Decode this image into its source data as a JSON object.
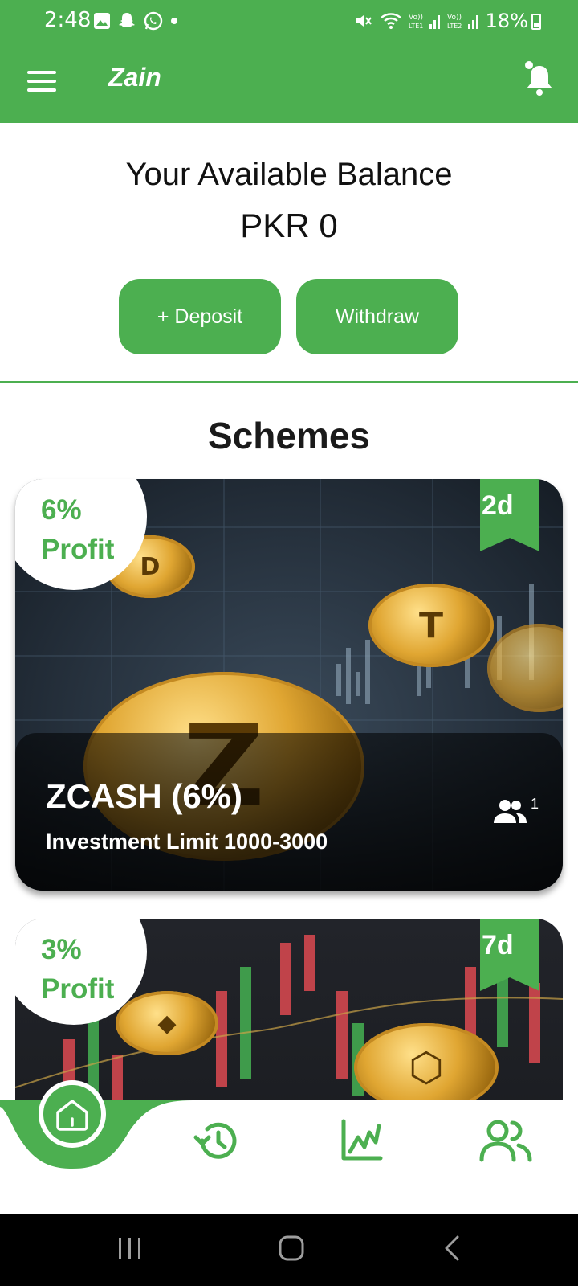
{
  "status_bar": {
    "time": "2:48",
    "battery": "18%",
    "network_labels": [
      "Vo)) LTE1",
      "Vo)) LTE2"
    ]
  },
  "app_bar": {
    "title": "Zain",
    "menu_icon": "hamburger-menu-icon",
    "notification_icon": "bell-icon"
  },
  "balance": {
    "label": "Your Available Balance",
    "value": "PKR 0"
  },
  "actions": {
    "deposit_label": "+ Deposit",
    "withdraw_label": "Withdraw"
  },
  "schemes": {
    "title": "Schemes",
    "items": [
      {
        "profit_percent": "6%",
        "profit_word": "Profit",
        "duration": "2d",
        "name": "ZCASH (6%)",
        "limit": "Investment Limit 1000-3000",
        "members": "1"
      },
      {
        "profit_percent": "3%",
        "profit_word": "Profit",
        "duration": "7d"
      }
    ]
  },
  "bottom_nav": {
    "items": [
      "home-icon",
      "history-icon",
      "chart-icon",
      "users-icon"
    ],
    "active": "home-icon",
    "accent_color": "#4caf50"
  },
  "colors": {
    "brand": "#4caf50",
    "text": "#111111"
  }
}
